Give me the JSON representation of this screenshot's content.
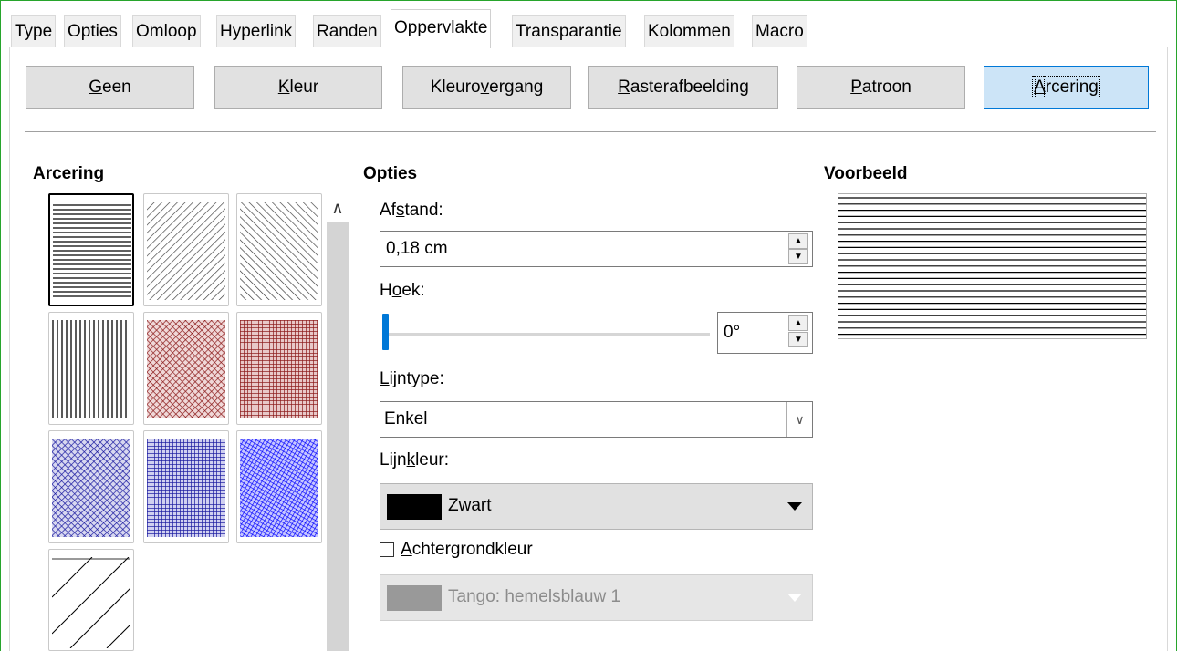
{
  "tabs": [
    {
      "label": "Type",
      "active": false
    },
    {
      "label": "Opties",
      "active": false
    },
    {
      "label": "Omloop",
      "active": false
    },
    {
      "label": "Hyperlink",
      "active": false
    },
    {
      "label": "Randen",
      "active": false
    },
    {
      "label": "Oppervlakte",
      "active": true
    },
    {
      "label": "Transparantie",
      "active": false
    },
    {
      "label": "Kolommen",
      "active": false
    },
    {
      "label": "Macro",
      "active": false
    }
  ],
  "fill_buttons": {
    "geen": {
      "pre": "",
      "key": "G",
      "post": "een"
    },
    "kleur": {
      "pre": "",
      "key": "K",
      "post": "leur"
    },
    "kleurovergang": {
      "pre": "Kleuro",
      "key": "v",
      "post": "ergang"
    },
    "rasterafbeelding": {
      "pre": "",
      "key": "R",
      "post": "asterafbeelding"
    },
    "patroon": {
      "pre": "",
      "key": "P",
      "post": "atroon"
    },
    "arcering": {
      "pre": "",
      "key": "A",
      "post": "rcering",
      "active": true
    }
  },
  "sections": {
    "hatch_heading": "Arcering",
    "options_heading": "Opties",
    "preview_heading": "Voorbeeld"
  },
  "hatch_swatches": [
    {
      "name": "black-0-degrees",
      "color": "#000000",
      "selected": true
    },
    {
      "name": "black-45-degrees",
      "color": "#000000"
    },
    {
      "name": "black-minus-45-degrees",
      "color": "#000000"
    },
    {
      "name": "black-90-degrees",
      "color": "#000000"
    },
    {
      "name": "red-crossed-45-degrees",
      "color": "#8b1a1a"
    },
    {
      "name": "red-crossed-0-degrees",
      "color": "#8b1a1a"
    },
    {
      "name": "blue-crossed-45-degrees",
      "color": "#1a1aa0"
    },
    {
      "name": "blue-crossed-0-degrees",
      "color": "#1a1aa0"
    },
    {
      "name": "blue-triple-90-degrees",
      "color": "#0000ff"
    },
    {
      "name": "black-wide-diagonal",
      "color": "#000000"
    }
  ],
  "options": {
    "spacing": {
      "label_pre": "Af",
      "label_key": "s",
      "label_post": "tand:",
      "value": "0,18 cm"
    },
    "angle": {
      "label_pre": "H",
      "label_key": "o",
      "label_post": "ek:",
      "value": "0°",
      "slider_fraction": 0.0
    },
    "line_type": {
      "label_pre": "",
      "label_key": "L",
      "label_post": "ijntype:",
      "value": "Enkel"
    },
    "line_color": {
      "label_pre": "Lijn",
      "label_key": "k",
      "label_post": "leur:",
      "value": "Zwart",
      "swatch": "#000000"
    },
    "background_color": {
      "label_pre": "",
      "label_key": "A",
      "label_post": "chtergrondkleur",
      "checked": false,
      "value": "Tango: hemelsblauw 1",
      "swatch": "#999999"
    }
  },
  "colors": {
    "accent": "#0078d7",
    "window_border": "#27a52c"
  }
}
